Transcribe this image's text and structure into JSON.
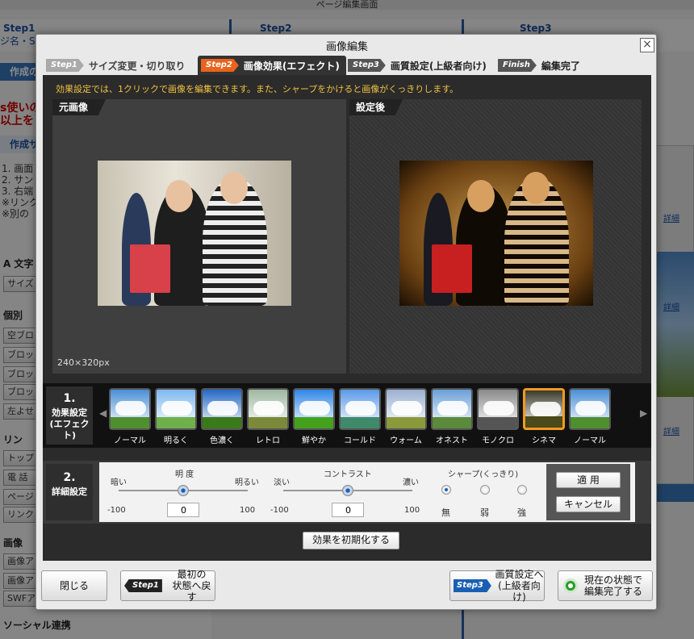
{
  "background": {
    "top_title": "ページ編集画面",
    "steps": [
      "Step1",
      "Step2",
      "Step3"
    ],
    "sub_title": "ジ名・S",
    "create_bar": "作成の",
    "red_text": [
      "s使いの",
      "以上を"
    ],
    "create_bar2": "作成サ",
    "list_lines": [
      "1. 画面",
      "2. サン",
      "3. 右端",
      "※リンク",
      "※別の"
    ],
    "text_header": "A 文字",
    "size_btn": "サイズ",
    "individual_header": "個別",
    "block_buttons": [
      "空ブロ",
      "ブロッ",
      "ブロッ",
      "ブロッ",
      "左よせ"
    ],
    "link_header": "リン",
    "link_buttons": [
      "トップ",
      "電 話",
      "ページ",
      "リンク"
    ],
    "image_header": "画像",
    "image_buttons": [
      "画像ア",
      "画像ア",
      "SWFア"
    ],
    "social_header": "ソーシャル連携",
    "right_links": [
      "詳細",
      "詳細",
      "詳細"
    ]
  },
  "dialog": {
    "title": "画像編集",
    "close": "×",
    "steps": [
      {
        "badge": "Step1",
        "label": "サイズ変更・切り取り",
        "color": "#aaaaaa"
      },
      {
        "badge": "Step2",
        "label": "画像効果(エフェクト)",
        "color": "#e8641c"
      },
      {
        "badge": "Step3",
        "label": "画質設定(上級者向け)",
        "color": "#555555"
      },
      {
        "badge": "Finish",
        "label": "編集完了",
        "color": "#555555"
      }
    ],
    "notice": "効果設定では、1クリックで画像を編集できます。また、シャープをかけると画像がくっきりします。",
    "original_tab": "元画像",
    "after_tab": "設定後",
    "size_label": "240×320px",
    "effects": {
      "number": "1.",
      "title_line1": "効果設定",
      "title_line2": "(エフェクト)",
      "prev": "◀",
      "next": "▶",
      "items": [
        {
          "name": "ノーマル",
          "sky": "#4a8fd6",
          "grass": "#4f8f2e",
          "selected": false
        },
        {
          "name": "明るく",
          "sky": "#7fb8ef",
          "grass": "#6fb04a",
          "selected": false
        },
        {
          "name": "色濃く",
          "sky": "#2368c4",
          "grass": "#3a7a1a",
          "selected": false
        },
        {
          "name": "レトロ",
          "sky": "#9fb8a0",
          "grass": "#7a8a3a",
          "selected": false
        },
        {
          "name": "鮮やか",
          "sky": "#2f86e8",
          "grass": "#44a11c",
          "selected": false
        },
        {
          "name": "コールド",
          "sky": "#5a9ae8",
          "grass": "#3f8a6a",
          "selected": false
        },
        {
          "name": "ウォーム",
          "sky": "#9ab0d0",
          "grass": "#8a9a3a",
          "selected": false
        },
        {
          "name": "オネスト",
          "sky": "#6aa0d8",
          "grass": "#5a8a3a",
          "selected": false
        },
        {
          "name": "モノクロ",
          "sky": "#8a8a8a",
          "grass": "#555555",
          "selected": false
        },
        {
          "name": "シネマ",
          "sky": "#3a3a2a",
          "grass": "#4a4a1a",
          "selected": true
        },
        {
          "name": "ノーマル",
          "sky": "#4a8fd6",
          "grass": "#4f8f2e",
          "selected": false
        }
      ]
    },
    "detail": {
      "number": "2.",
      "title": "詳細設定",
      "brightness": {
        "label": "明 度",
        "low": "暗い",
        "high": "明るい",
        "min": "-100",
        "max": "100",
        "value": "0"
      },
      "contrast": {
        "label": "コントラスト",
        "low": "淡い",
        "high": "濃い",
        "min": "-100",
        "max": "100",
        "value": "0"
      },
      "sharp": {
        "label": "シャープ(くっきり)",
        "options": [
          "無",
          "弱",
          "強"
        ],
        "selected": 0
      },
      "apply": "適 用",
      "cancel": "キャンセル"
    },
    "reset": "効果を初期化する",
    "footer": {
      "close": "閉じる",
      "back_badge": "Step1",
      "back_line1": "最初の",
      "back_line2": "状態へ戻す",
      "next_badge": "Step3",
      "next_line1": "画質設定へ",
      "next_line2": "(上級者向け)",
      "finish_line1": "現在の状態で",
      "finish_line2": "編集完了する"
    }
  }
}
